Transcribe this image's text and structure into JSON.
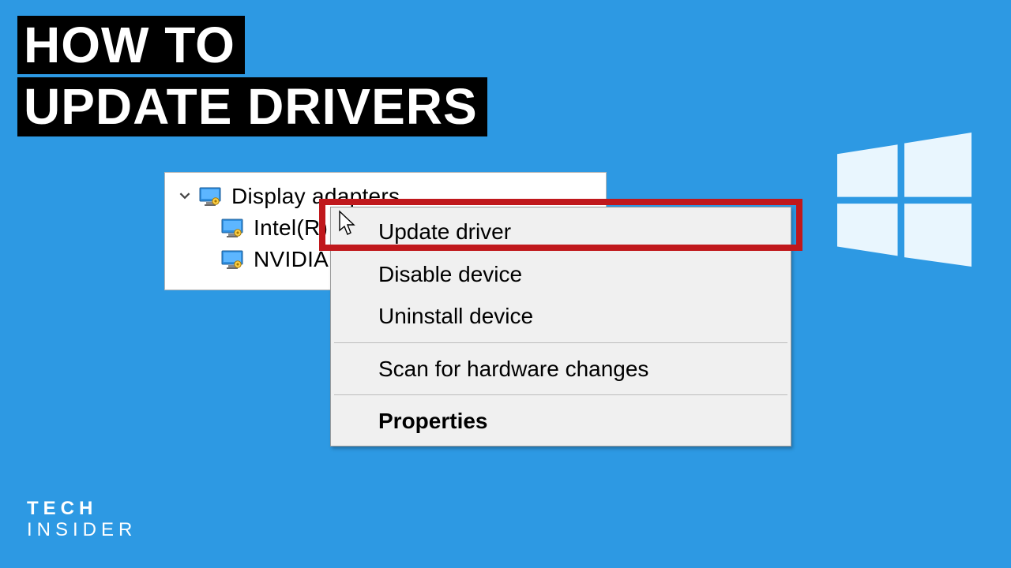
{
  "title": {
    "line1": "HOW TO",
    "line2": "UPDATE DRIVERS"
  },
  "device_manager": {
    "parent": "Display adapters",
    "children": [
      "Intel(R)",
      "NVIDIA"
    ]
  },
  "context_menu": {
    "items": [
      {
        "label": "Update driver",
        "bold": false,
        "highlighted": true
      },
      {
        "label": "Disable device",
        "bold": false
      },
      {
        "label": "Uninstall device",
        "bold": false
      },
      {
        "sep": true
      },
      {
        "label": "Scan for hardware changes",
        "bold": false
      },
      {
        "sep": true
      },
      {
        "label": "Properties",
        "bold": true
      }
    ]
  },
  "brand": {
    "line1": "TECH",
    "line2": "INSIDER"
  },
  "icons": {
    "chevron_down": "chevron-down-icon",
    "display_adapter": "display-adapter-icon",
    "windows_logo": "windows-logo-icon",
    "cursor": "cursor-icon"
  },
  "colors": {
    "background": "#2d99e3",
    "highlight": "#c0181c",
    "logo": "#e9f6fe"
  }
}
